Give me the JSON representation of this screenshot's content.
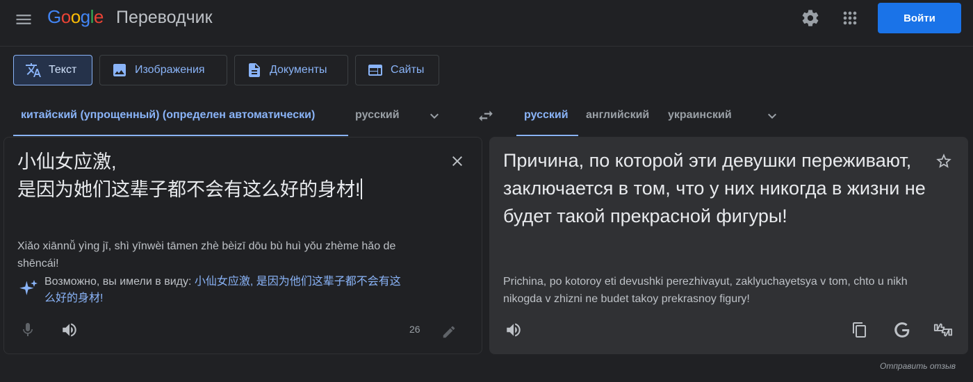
{
  "header": {
    "logo_text": "Google",
    "product": "Переводчик",
    "login_label": "Войти",
    "brand_colors": [
      "#4285F4",
      "#EA4335",
      "#FBBC05",
      "#4285F4",
      "#34A853",
      "#EA4335"
    ]
  },
  "modes": [
    {
      "label": "Текст",
      "icon": "translate-icon",
      "active": true
    },
    {
      "label": "Изображения",
      "icon": "image-icon"
    },
    {
      "label": "Документы",
      "icon": "document-icon"
    },
    {
      "label": "Сайты",
      "icon": "website-icon"
    }
  ],
  "source_langs": [
    "китайский (упрощенный) (определен автоматически)",
    "русский"
  ],
  "target_langs": [
    "русский",
    "английский",
    "украинский"
  ],
  "source": {
    "text_line1": "小仙女应激,",
    "text_line2": "是因为她们这辈子都不会有这么好的身材!",
    "transliteration_line1": "Xiǎo xiānnǚ yìng jī, shì yīnwèi tāmen zhè bèizī dōu bù huì yǒu zhème hǎo de",
    "transliteration_line2": "shēncái!",
    "suggestion_prefix": "Возможно, вы имели в виду:",
    "suggestion_line1": "小仙女应激, 是因为他们这辈子都不会有这",
    "suggestion_line2": "么好的身材!",
    "char_count": "26"
  },
  "target": {
    "text": "Причина, по которой эти девушки переживают, заключается в том, что у них никогда в жизни не будет такой прекрасной фигуры!",
    "transliteration": "Prichina, po kotoroy eti devushki perezhivayut, zaklyuchayetsya v tom, chto u nikh nikogda v zhizni ne budet takoy prekrasnoy figury!"
  },
  "feedback_label": "Отправить отзыв",
  "colors": {
    "background": "#202124",
    "accent": "#8ab4f8",
    "button": "#1a73e8",
    "panel": "#303134"
  }
}
